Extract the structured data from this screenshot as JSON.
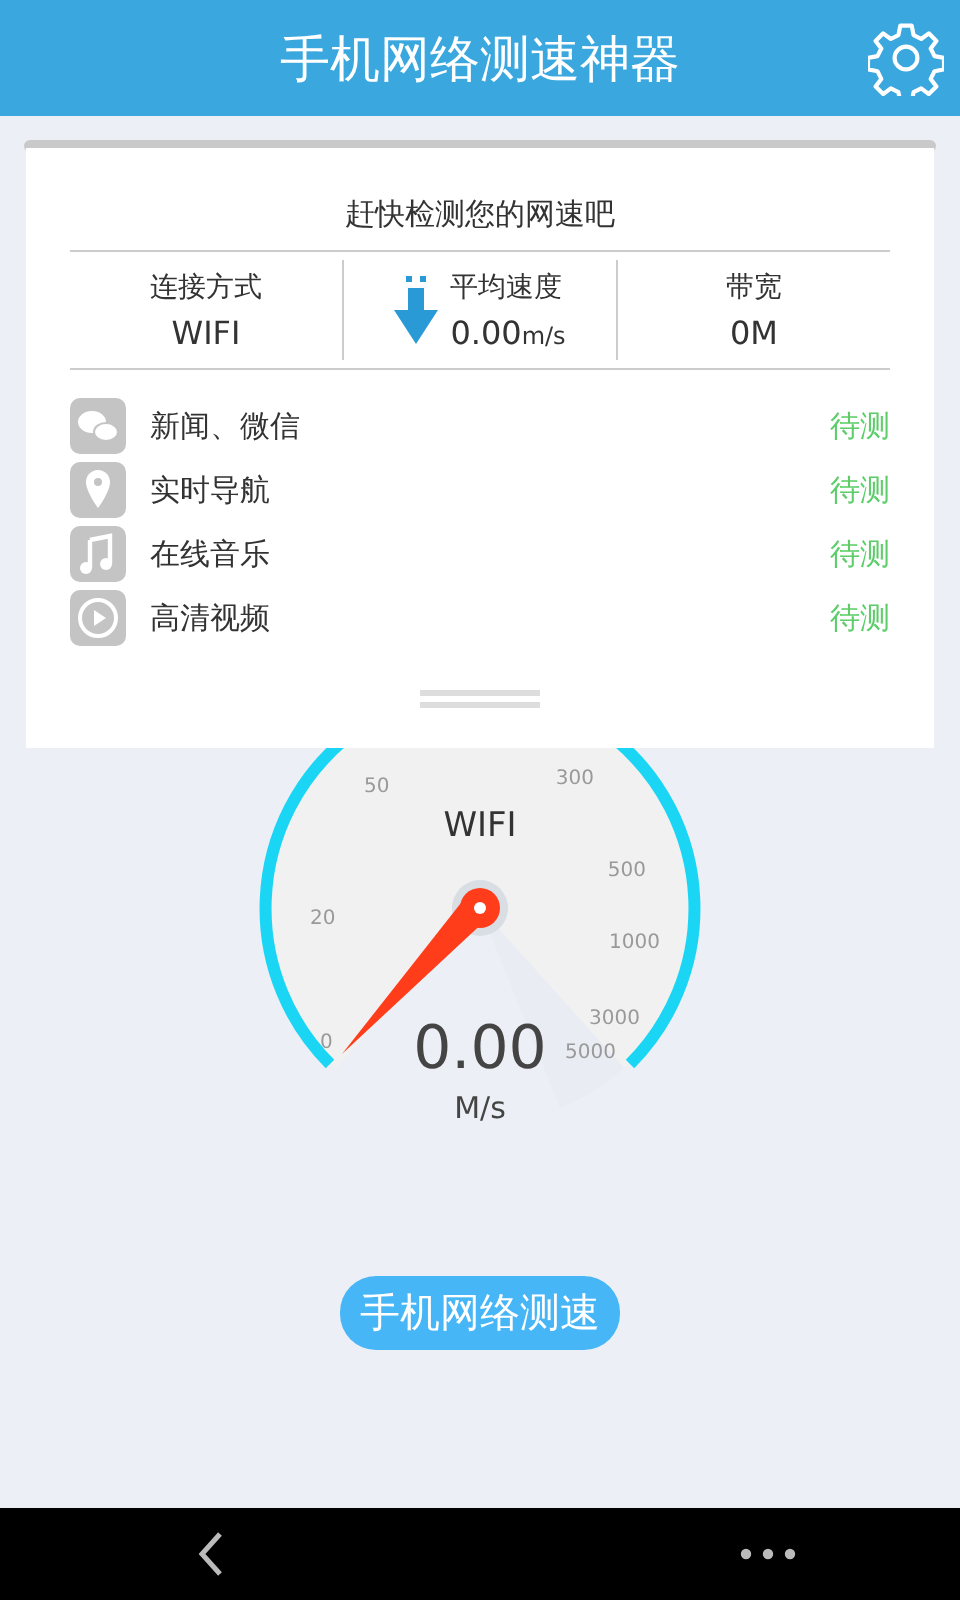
{
  "header": {
    "title": "手机网络测速神器"
  },
  "card": {
    "prompt": "赶快检测您的网速吧",
    "stats": [
      {
        "label": "连接方式",
        "value": "WIFI",
        "kind": "plain"
      },
      {
        "label": "平均速度",
        "value": "0.00",
        "unit": "m/s",
        "kind": "speed"
      },
      {
        "label": "带宽",
        "value": "0M",
        "kind": "plain"
      }
    ],
    "tests": [
      {
        "kind": "chat",
        "label": "新闻、微信",
        "status": "待测"
      },
      {
        "kind": "pin",
        "label": "实时导航",
        "status": "待测"
      },
      {
        "kind": "music",
        "label": "在线音乐",
        "status": "待测"
      },
      {
        "kind": "play",
        "label": "高清视频",
        "status": "待测"
      }
    ]
  },
  "gauge": {
    "network": "WIFI",
    "reading": "0.00",
    "unit": "M/s",
    "left_ticks": [
      "50",
      "20",
      "0"
    ],
    "right_ticks": [
      "300",
      "500",
      "1000",
      "3000",
      "5000"
    ]
  },
  "start_button": "手机网络测速"
}
